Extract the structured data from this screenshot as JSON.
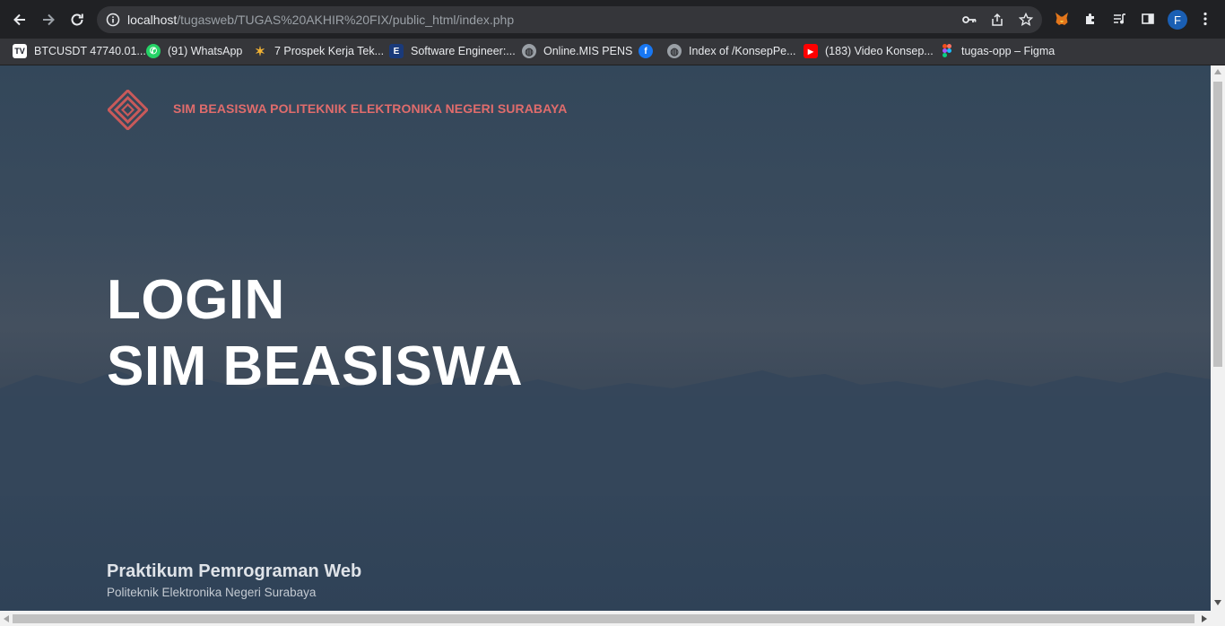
{
  "browser": {
    "url_host": "localhost",
    "url_path": "/tugasweb/TUGAS%20AKHIR%20FIX/public_html/index.php",
    "profile_initial": "F"
  },
  "bookmarks": [
    {
      "label": "BTCUSDT 47740.01...",
      "icon": "tradingview-icon"
    },
    {
      "label": "(91) WhatsApp",
      "icon": "whatsapp-icon"
    },
    {
      "label": "7 Prospek Kerja Tek...",
      "icon": "star-logo-icon"
    },
    {
      "label": "Software Engineer:...",
      "icon": "e-logo-icon"
    },
    {
      "label": "Online.MIS PENS",
      "icon": "globe-icon"
    },
    {
      "label": "",
      "icon": "facebook-icon"
    },
    {
      "label": "Index of /KonsepPe...",
      "icon": "globe-icon"
    },
    {
      "label": "(183) Video Konsep...",
      "icon": "youtube-icon"
    },
    {
      "label": "tugas-opp – Figma",
      "icon": "figma-icon"
    }
  ],
  "page": {
    "site_title": "SIM BEASISWA POLITEKNIK ELEKTRONIKA NEGERI SURABAYA",
    "hero_line1": "LOGIN",
    "hero_line2": "SIM BEASISWA",
    "footer_title": "Praktikum Pemrograman Web",
    "footer_subtitle": "Politeknik Elektronika Negeri Surabaya"
  },
  "colors": {
    "accent": "#e06c6c",
    "page_bg": "#33475a",
    "toolbar_bg": "#202124"
  }
}
